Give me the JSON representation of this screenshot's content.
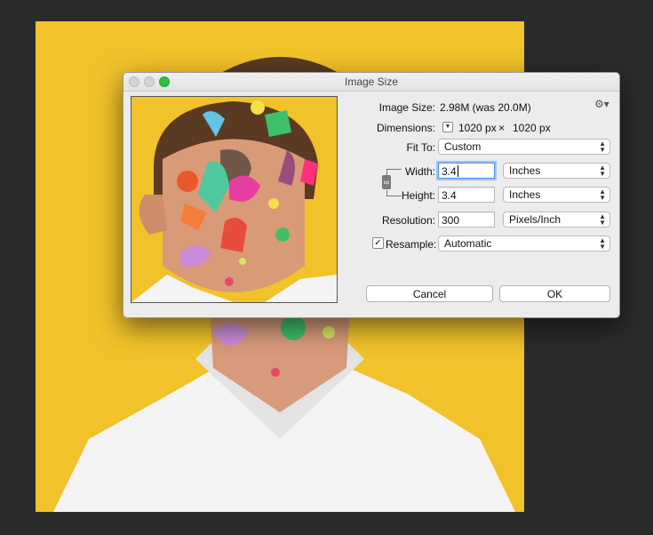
{
  "window": {
    "title": "Image Size"
  },
  "info": {
    "image_size_label": "Image Size:",
    "image_size_value": "2.98M (was 20.0M)",
    "dimensions_label": "Dimensions:",
    "dimensions_width": "1020 px",
    "dimensions_times": "×",
    "dimensions_height": "1020 px"
  },
  "fit_to": {
    "label": "Fit To:",
    "value": "Custom"
  },
  "width": {
    "label": "Width:",
    "value": "3.4",
    "unit": "Inches"
  },
  "height": {
    "label": "Height:",
    "value": "3.4",
    "unit": "Inches"
  },
  "resolution": {
    "label": "Resolution:",
    "value": "300",
    "unit": "Pixels/Inch"
  },
  "resample": {
    "label": "Resample:",
    "checked": "✓",
    "value": "Automatic"
  },
  "buttons": {
    "cancel": "Cancel",
    "ok": "OK"
  },
  "icons": {
    "gear": "gear-icon",
    "link": "link-icon",
    "disclosure": "chevron-down-icon"
  },
  "colors": {
    "background_yellow": "#f1c22a",
    "accent_focus": "#4b92e8",
    "zoom_green": "#2fc23f"
  }
}
